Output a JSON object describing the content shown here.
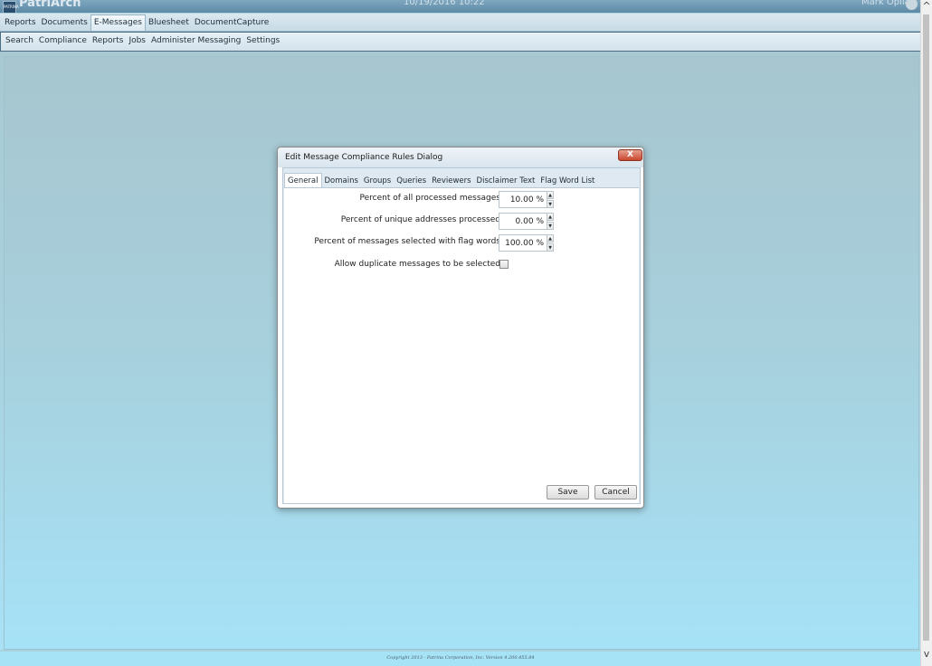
{
  "app": {
    "name": "PatriArch",
    "logo_text": "PATRINA",
    "datetime": "10/19/2016 10:22",
    "username": "Mark Opila"
  },
  "main_menu": [
    "Reports",
    "Documents",
    "E-Messages",
    "Bluesheet",
    "DocumentCapture"
  ],
  "main_menu_active": "E-Messages",
  "sub_menu": [
    "Search",
    "Compliance",
    "Reports",
    "Jobs",
    "Administer Messaging",
    "Settings"
  ],
  "dialog": {
    "title": "Edit Message Compliance Rules Dialog",
    "close_label": "X",
    "tabs": [
      "General",
      "Domains",
      "Groups",
      "Queries",
      "Reviewers",
      "Disclaimer Text",
      "Flag Word List"
    ],
    "active_tab": "General",
    "fields": [
      {
        "label": "Percent of all processed messages",
        "value": "10.00 %"
      },
      {
        "label": "Percent of unique addresses processed",
        "value": "0.00 %"
      },
      {
        "label": "Percent of messages selected with flag words",
        "value": "100.00 %"
      }
    ],
    "checkbox": {
      "label": "Allow duplicate messages to be selected",
      "checked": false
    },
    "save_label": "Save",
    "cancel_label": "Cancel"
  },
  "footer": "Copyright 2013 - Patrina Corporation, Inc. Version 4.200.455.84",
  "icons": {
    "spin_up": "▲",
    "spin_down": "▼",
    "scroll_up": "^",
    "scroll_down": "v"
  }
}
